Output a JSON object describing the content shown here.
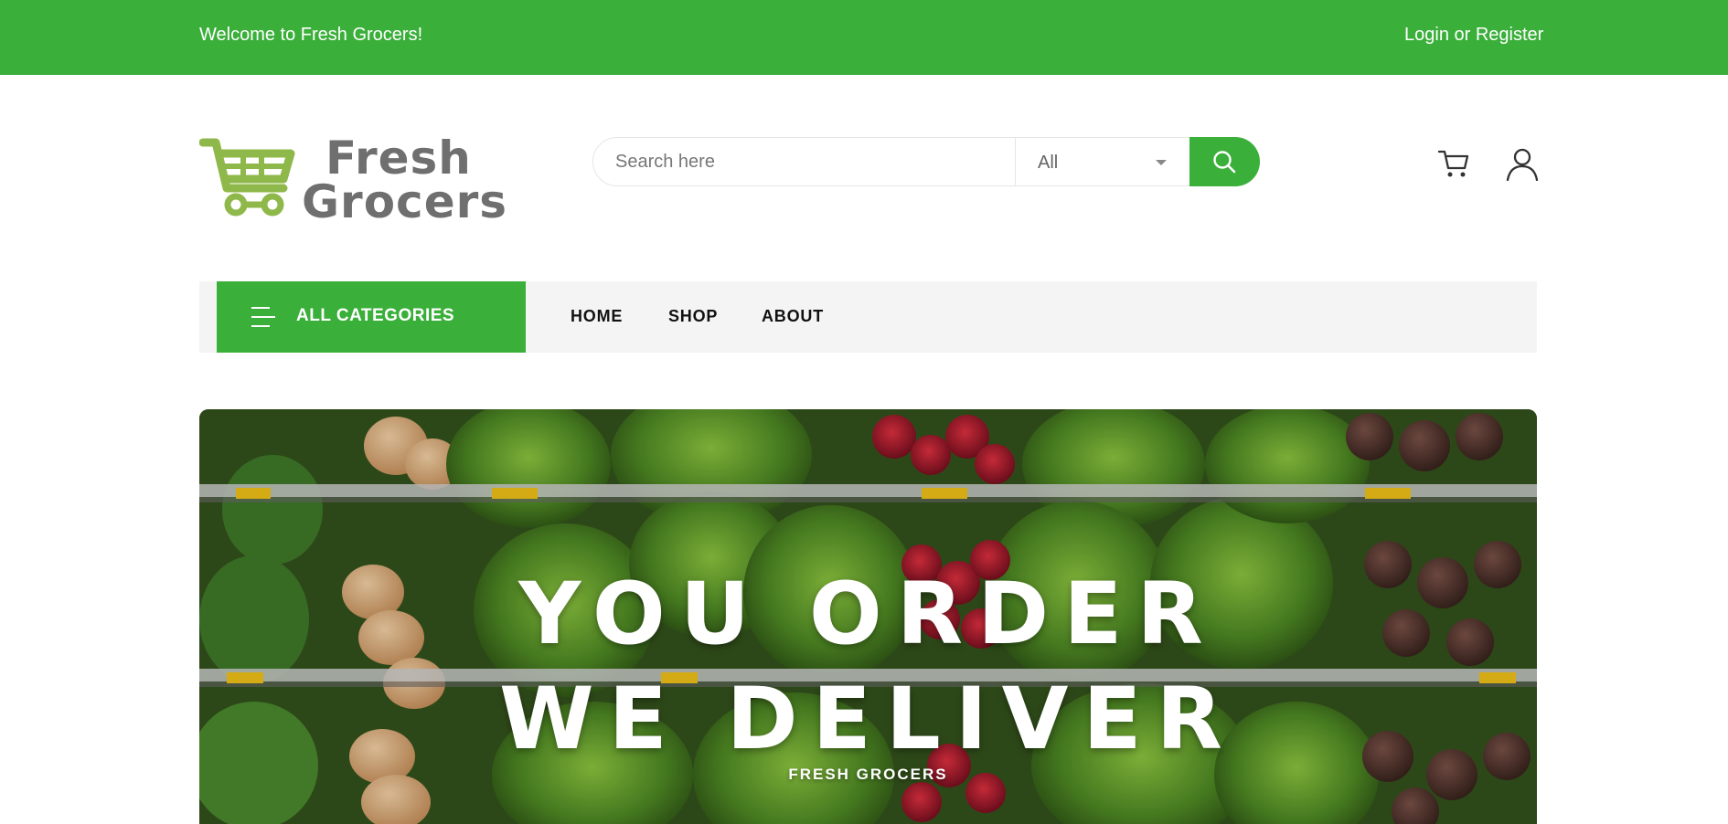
{
  "topbar": {
    "welcome": "Welcome to Fresh Grocers!",
    "login": "Login or Register"
  },
  "logo": {
    "line1": "Fresh",
    "line2": "Grocers",
    "icon": "shopping-cart-icon"
  },
  "search": {
    "placeholder": "Search here",
    "category_selected": "All",
    "button_icon": "search-icon"
  },
  "header_icons": [
    "cart-icon",
    "user-icon"
  ],
  "nav": {
    "all_categories": "ALL CATEGORIES",
    "links": [
      "HOME",
      "SHOP",
      "ABOUT"
    ]
  },
  "hero": {
    "line1": "YOU ORDER",
    "line2": "WE DELIVER",
    "subtitle": "FRESH GROCERS"
  },
  "colors": {
    "brand_green": "#3aaf3a",
    "logo_green": "#8fb84a",
    "logo_gray": "#6f6f6f",
    "nav_bg": "#f4f4f4"
  }
}
